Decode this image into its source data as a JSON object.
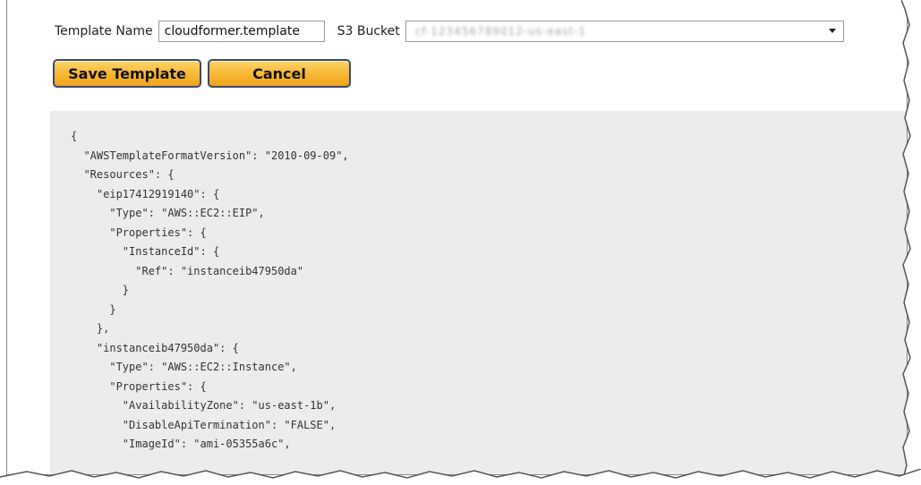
{
  "form": {
    "template_name_label": "Template Name",
    "template_name_value": "cloudformer.template",
    "s3_bucket_label": "S3 Bucket",
    "s3_bucket_value": "cf-123456789012-us-east-1"
  },
  "buttons": {
    "save_label": "Save Template",
    "cancel_label": "Cancel"
  },
  "code_lines": [
    "{",
    "  \"AWSTemplateFormatVersion\": \"2010-09-09\",",
    "  \"Resources\": {",
    "    \"eip17412919140\": {",
    "      \"Type\": \"AWS::EC2::EIP\",",
    "      \"Properties\": {",
    "        \"InstanceId\": {",
    "          \"Ref\": \"instanceib47950da\"",
    "        }",
    "      }",
    "    },",
    "    \"instanceib47950da\": {",
    "      \"Type\": \"AWS::EC2::Instance\",",
    "      \"Properties\": {",
    "        \"AvailabilityZone\": \"us-east-1b\",",
    "        \"DisableApiTermination\": \"FALSE\",",
    "        \"ImageId\": \"ami-05355a6c\","
  ],
  "colors": {
    "button_fill": "#f7b733",
    "button_border": "#3b4a6b",
    "code_background": "#ececec"
  }
}
